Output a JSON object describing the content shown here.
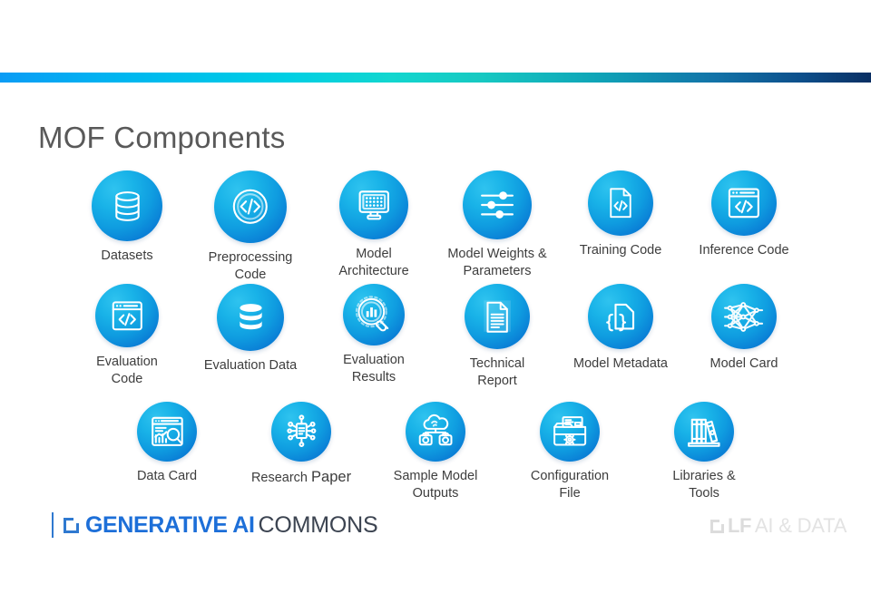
{
  "slide": {
    "title": "MOF Components",
    "background_color": "#ffffff",
    "title_color": "#595959"
  },
  "topbar": {
    "gradient_from": "#0a9cf5",
    "gradient_mid": "#12d6cf",
    "gradient_to": "#0a2f63"
  },
  "rows": [
    {
      "items": [
        {
          "label": "Datasets",
          "icon": "database-outline-icon",
          "size": 78
        },
        {
          "label": "Preprocessing\nCode",
          "icon": "code-circle-icon",
          "size": 80
        },
        {
          "label": "Model\nArchitecture",
          "icon": "monitor-grid-icon",
          "size": 76
        },
        {
          "label": "Model Weights &\nParameters",
          "icon": "sliders-icon",
          "size": 76
        },
        {
          "label": "Training Code",
          "icon": "code-file-icon",
          "size": 72
        },
        {
          "label": "Inference Code",
          "icon": "code-window-icon",
          "size": 72
        }
      ]
    },
    {
      "items": [
        {
          "label": "Evaluation\nCode",
          "icon": "code-window-icon",
          "size": 70
        },
        {
          "label": "Evaluation Data",
          "icon": "database-solid-icon",
          "size": 74
        },
        {
          "label": "Evaluation\nResults",
          "icon": "magnifier-chart-icon",
          "size": 68
        },
        {
          "label": "Technical\nReport",
          "icon": "document-lines-icon",
          "size": 72
        },
        {
          "label": "Model Metadata",
          "icon": "braces-document-icon",
          "size": 72
        },
        {
          "label": "Model Card",
          "icon": "neural-network-icon",
          "size": 72
        }
      ]
    },
    {
      "items": [
        {
          "label": "Data Card",
          "icon": "dashboard-search-icon",
          "size": 66
        },
        {
          "label": "Research <big>Paper</big>",
          "icon": "document-nodes-icon",
          "size": 66
        },
        {
          "label": "Sample Model\nOutputs",
          "icon": "cloud-cameras-icon",
          "size": 66
        },
        {
          "label": "Configuration\nFile",
          "icon": "folder-gear-icon",
          "size": 66
        },
        {
          "label": "Libraries &\nTools",
          "icon": "books-icon",
          "size": 66
        }
      ]
    }
  ],
  "footer": {
    "generative_ai_commons": {
      "strong_text": "GENERATIVE AI",
      "light_text": "COMMONS",
      "strong_color": "#1d6fd8",
      "light_color": "#3c4451"
    },
    "lf_ai_data": {
      "strong_text": "LF",
      "light_text": "AI & DATA",
      "color": "#dcdcdc"
    }
  }
}
